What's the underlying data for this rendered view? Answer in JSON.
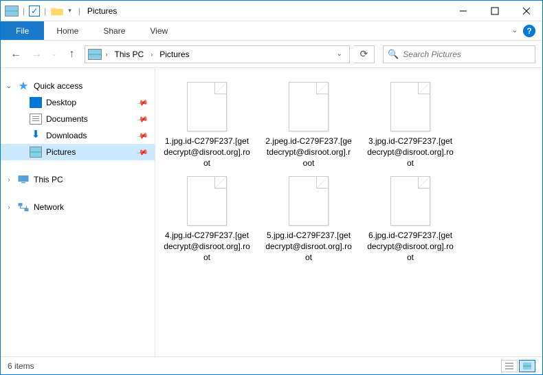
{
  "title_bar": {
    "window_title": "Pictures"
  },
  "ribbon": {
    "file": "File",
    "home": "Home",
    "share": "Share",
    "view": "View"
  },
  "address": {
    "this_pc": "This PC",
    "current": "Pictures"
  },
  "search": {
    "placeholder": "Search Pictures"
  },
  "sidebar": {
    "quick_access": "Quick access",
    "desktop": "Desktop",
    "documents": "Documents",
    "downloads": "Downloads",
    "pictures": "Pictures",
    "this_pc": "This PC",
    "network": "Network"
  },
  "files": [
    {
      "name": "1.jpg.id-C279F237.[getdecrypt@disroot.org].root"
    },
    {
      "name": "2.jpeg.id-C279F237.[getdecrypt@disroot.org].root"
    },
    {
      "name": "3.jpg.id-C279F237.[getdecrypt@disroot.org].root"
    },
    {
      "name": "4.jpg.id-C279F237.[getdecrypt@disroot.org].root"
    },
    {
      "name": "5.jpg.id-C279F237.[getdecrypt@disroot.org].root"
    },
    {
      "name": "6.jpg.id-C279F237.[getdecrypt@disroot.org].root"
    }
  ],
  "status": {
    "count_text": "6 items"
  }
}
